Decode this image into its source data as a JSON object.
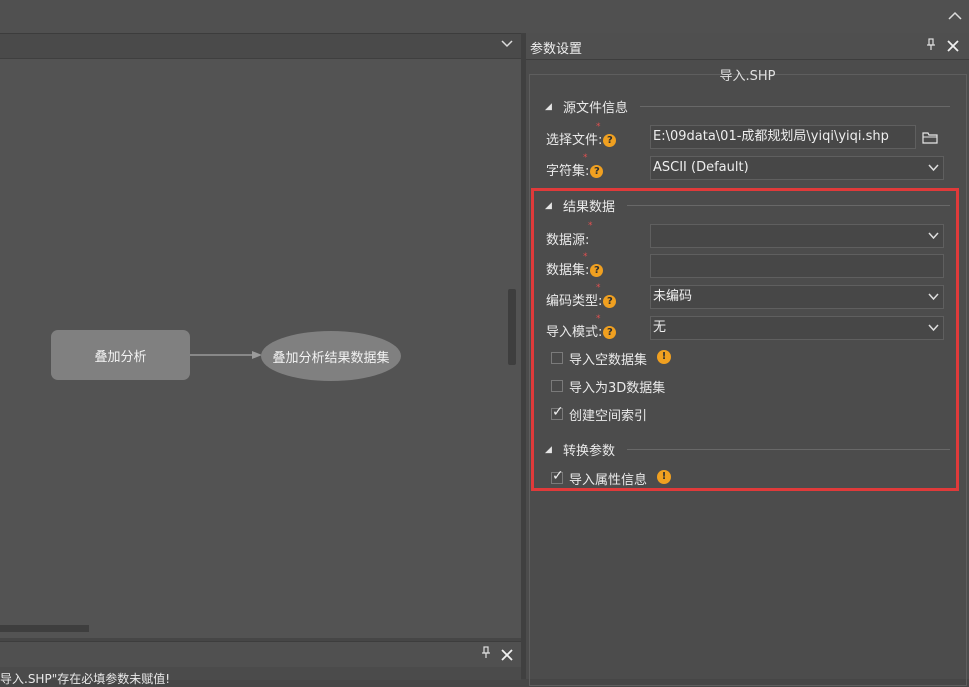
{
  "window": {
    "collapse_icon": "chevron-up-icon"
  },
  "canvas": {
    "dropdown_icon": "chevron-down-icon",
    "node_process": "叠加分析",
    "node_result": "叠加分析结果数据集"
  },
  "output": {
    "message": "导入.SHP\"存在必填参数未赋值!"
  },
  "props": {
    "title": "参数设置",
    "group_title": "导入.SHP",
    "sections": {
      "source": "源文件信息",
      "result": "结果数据",
      "convert": "转换参数"
    },
    "fields": {
      "file_label": "选择文件:",
      "file_value": "E:\\09data\\01-成都规划局\\yiqi\\yiqi.shp",
      "charset_label": "字符集:",
      "charset_value": "ASCII (Default)",
      "datasource_label": "数据源:",
      "datasource_value": "",
      "dataset_label": "数据集:",
      "dataset_value": "",
      "encode_label": "编码类型:",
      "encode_value": "未编码",
      "mode_label": "导入模式:",
      "mode_value": "无"
    },
    "checkboxes": {
      "import_empty": {
        "label": "导入空数据集",
        "checked": false
      },
      "import_3d": {
        "label": "导入为3D数据集",
        "checked": false
      },
      "spatial_index": {
        "label": "创建空间索引",
        "checked": true
      },
      "import_attr": {
        "label": "导入属性信息",
        "checked": true
      }
    },
    "required_mark": "*",
    "help_glyph": "?",
    "warn_glyph": "!"
  },
  "colors": {
    "highlight_border": "#e03a3a",
    "help_icon": "#f0a020"
  }
}
